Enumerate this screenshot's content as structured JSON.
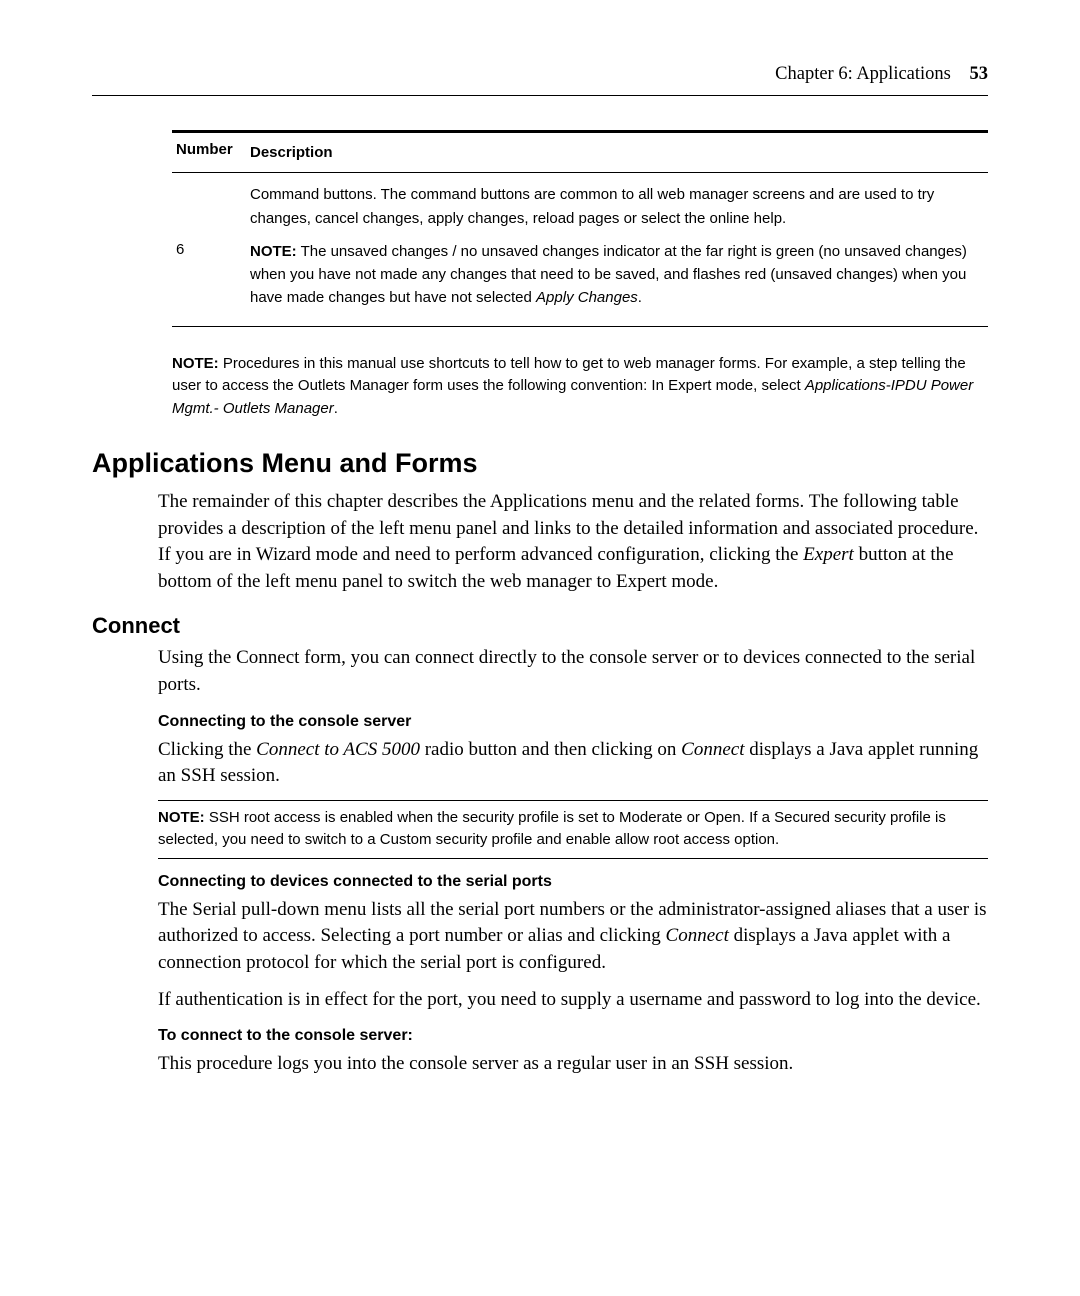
{
  "header": {
    "chapter_label": "Chapter 6: Applications",
    "page_number": "53"
  },
  "table": {
    "head_number": "Number",
    "head_description": "Description",
    "row_number": "6",
    "row_desc_p1": "Command buttons. The command buttons are common to all web manager screens and are used to try changes, cancel changes, apply changes, reload pages or select the online help.",
    "row_desc_note_lead": "NOTE:",
    "row_desc_note_body_a": " The unsaved changes / no unsaved changes indicator at the far right is green (no unsaved changes) when you have not made any changes that need to be saved, and flashes red (unsaved changes) when you have made changes but have not selected ",
    "row_desc_note_body_ital": "Apply Changes",
    "row_desc_note_body_b": "."
  },
  "after_note": {
    "lead": "NOTE:",
    "body_a": " Procedures in this manual use shortcuts to tell how to get to web manager forms. For example, a step telling the user to access the Outlets Manager form uses the following convention: In Expert mode, select ",
    "ital": "Applications-IPDU Power Mgmt.- Outlets Manager",
    "body_b": "."
  },
  "h1": "Applications Menu and Forms",
  "p_intro_a": "The remainder of this chapter describes the Applications menu and the related forms. The following table provides a description of the left menu panel and links to the detailed information and associated procedure. If you are in Wizard mode and need to perform advanced configuration, clicking the ",
  "p_intro_ital": "Expert",
  "p_intro_b": " button at the bottom of the left menu panel to switch the web manager to Expert mode.",
  "h2_connect": "Connect",
  "p_connect": "Using the Connect form, you can connect directly to the console server or to devices connected to the serial ports.",
  "h3_conn_server": "Connecting to the console server",
  "p_conn_server_a": "Clicking the ",
  "p_conn_server_ital1": "Connect to ACS 5000",
  "p_conn_server_b": " radio button and then clicking on ",
  "p_conn_server_ital2": "Connect",
  "p_conn_server_c": " displays a Java applet running an SSH session.",
  "inline_note_lead": "NOTE:",
  "inline_note_body": " SSH root access is enabled when the security profile is set to Moderate or Open. If a Secured security profile is selected, you need to switch to a Custom security profile and enable allow root access option.",
  "h3_conn_devices": "Connecting to devices connected to the serial ports",
  "p_devices_a": "The Serial pull-down menu lists all the serial port numbers or the administrator-assigned aliases that a user is authorized to access. Selecting a port number or alias and clicking ",
  "p_devices_ital": "Connect",
  "p_devices_b": " displays a Java applet with a connection protocol for which the serial port is configured.",
  "p_auth": "If authentication is in effect for the port, you need to supply a username and password to log into the device.",
  "h3_to_connect": "To connect to the console server:",
  "p_to_connect": "This procedure logs you into the console server as a regular user in an SSH session."
}
